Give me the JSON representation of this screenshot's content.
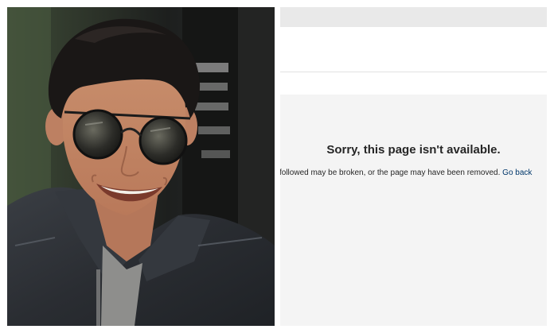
{
  "error_page": {
    "title": "Sorry, this page isn't available.",
    "body": "followed may be broken, or the page may have been removed.",
    "go_back_link": "Go back"
  },
  "colors": {
    "link": "#00376b",
    "text": "#262626",
    "page_background": "#f4f4f4"
  }
}
